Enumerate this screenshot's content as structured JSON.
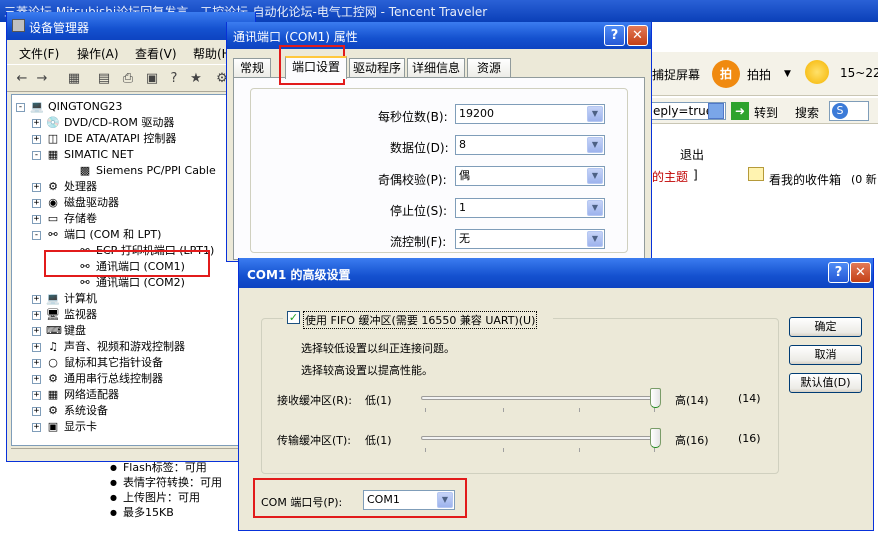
{
  "background_window": {
    "title": "三菱论坛  Mitsubishi论坛回复发言 - 工控论坛-自动化论坛-电气工控网 - Tencent Traveler",
    "toolbar_capture": "捕捉屏幕",
    "toolbar_paipai": "拍拍",
    "toolbar_weather": "15~22",
    "address_fragment": "eply=true",
    "goto_label": "转到",
    "search_label": "搜索",
    "exit_text": "退出",
    "my_topics_text": "的主题",
    "my_topics_bracket": "]",
    "inbox_text": "看我的收件箱",
    "inbox_count": "(0 新",
    "features": [
      "Flash标签：可用",
      "表情字符转换：可用",
      "上传图片：可用",
      "最多15KB"
    ]
  },
  "device_manager": {
    "title": "设备管理器",
    "menu": [
      "文件(F)",
      "操作(A)",
      "查看(V)",
      "帮助(H)"
    ],
    "tree": {
      "root": "QINGTONG23",
      "items": [
        {
          "label": "DVD/CD-ROM 驱动器",
          "expander": "+"
        },
        {
          "label": "IDE ATA/ATAPI 控制器",
          "expander": "+"
        },
        {
          "label": "SIMATIC NET",
          "expander": "-"
        },
        {
          "label": "Siemens PC/PPI Cable",
          "expander": ""
        },
        {
          "label": "处理器",
          "expander": "+"
        },
        {
          "label": "磁盘驱动器",
          "expander": "+"
        },
        {
          "label": "存储卷",
          "expander": "+"
        },
        {
          "label": "端口 (COM 和 LPT)",
          "expander": "-"
        },
        {
          "label": "ECP 打印机端口 (LPT1)",
          "expander": ""
        },
        {
          "label": "通讯端口 (COM1)",
          "expander": ""
        },
        {
          "label": "通讯端口 (COM2)",
          "expander": ""
        },
        {
          "label": "计算机",
          "expander": "+"
        },
        {
          "label": "监视器",
          "expander": "+"
        },
        {
          "label": "键盘",
          "expander": "+"
        },
        {
          "label": "声音、视频和游戏控制器",
          "expander": "+"
        },
        {
          "label": "鼠标和其它指针设备",
          "expander": "+"
        },
        {
          "label": "通用串行总线控制器",
          "expander": "+"
        },
        {
          "label": "网络适配器",
          "expander": "+"
        },
        {
          "label": "系统设备",
          "expander": "+"
        },
        {
          "label": "显示卡",
          "expander": "+"
        }
      ]
    }
  },
  "properties_dialog": {
    "title": "通讯端口 (COM1) 属性",
    "tabs": [
      "常规",
      "端口设置",
      "驱动程序",
      "详细信息",
      "资源"
    ],
    "active_tab": "端口设置",
    "fields": [
      {
        "label": "每秒位数(B):",
        "value": "19200"
      },
      {
        "label": "数据位(D):",
        "value": "8"
      },
      {
        "label": "奇偶校验(P):",
        "value": "偶"
      },
      {
        "label": "停止位(S):",
        "value": "1"
      },
      {
        "label": "流控制(F):",
        "value": "无"
      }
    ]
  },
  "advanced_dialog": {
    "title": "COM1 的高级设置",
    "fifo_label": "使用 FIFO 缓冲区(需要 16550 兼容 UART)(U)",
    "fifo_checked": true,
    "hint1": "选择较低设置以纠正连接问题。",
    "hint2": "选择较高设置以提高性能。",
    "receive": {
      "label": "接收缓冲区(R):",
      "low": "低(1)",
      "high": "高(14)",
      "value": "(14)",
      "level": 1.0
    },
    "transmit": {
      "label": "传输缓冲区(T):",
      "low": "低(1)",
      "high": "高(16)",
      "value": "(16)",
      "level": 1.0
    },
    "ok": "确定",
    "cancel": "取消",
    "defaults": "默认值(D)",
    "com_port_label": "COM 端口号(P):",
    "com_port_value": "COM1"
  },
  "colors": {
    "xp_blue": "#0d43c1",
    "highlight_red": "#e21b1b"
  }
}
